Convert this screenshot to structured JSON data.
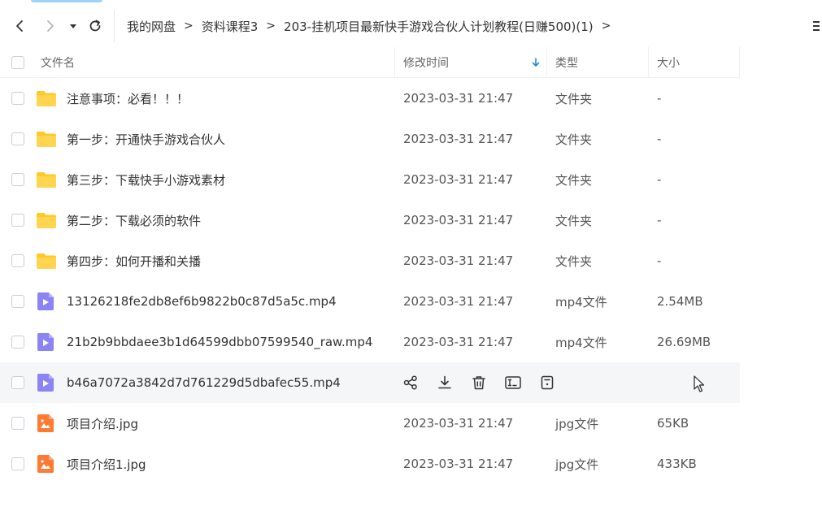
{
  "breadcrumbs": [
    "我的网盘",
    "资料课程3",
    "203-挂机项目最新快手游戏合伙人计划教程(日赚500)(1)"
  ],
  "crumb_separator": ">",
  "columns": {
    "name": "文件名",
    "modified": "修改时间",
    "type": "类型",
    "size": "大小"
  },
  "sort": {
    "column": "modified",
    "direction": "descending"
  },
  "files": [
    {
      "icon": "folder-icon",
      "name": "注意事项：必看！！！",
      "modified": "2023-03-31 21:47",
      "type": "文件夹",
      "size": "-"
    },
    {
      "icon": "folder-icon",
      "name": "第一步：开通快手游戏合伙人",
      "modified": "2023-03-31 21:47",
      "type": "文件夹",
      "size": "-"
    },
    {
      "icon": "folder-icon",
      "name": "第三步：下载快手小游戏素材",
      "modified": "2023-03-31 21:47",
      "type": "文件夹",
      "size": "-"
    },
    {
      "icon": "folder-icon",
      "name": "第二步：下载必须的软件",
      "modified": "2023-03-31 21:47",
      "type": "文件夹",
      "size": "-"
    },
    {
      "icon": "folder-icon",
      "name": "第四步：如何开播和关播",
      "modified": "2023-03-31 21:47",
      "type": "文件夹",
      "size": "-"
    },
    {
      "icon": "video-file-icon",
      "name": "13126218fe2db8ef6b9822b0c87d5a5c.mp4",
      "modified": "2023-03-31 21:47",
      "type": "mp4文件",
      "size": "2.54MB"
    },
    {
      "icon": "video-file-icon",
      "name": "21b2b9bbdaee3b1d64599dbb07599540_raw.mp4",
      "modified": "2023-03-31 21:47",
      "type": "mp4文件",
      "size": "26.69MB"
    },
    {
      "icon": "video-file-icon",
      "name": "b46a7072a3842d7d761229d5dbafec55.mp4",
      "modified": "",
      "type": "",
      "size": "",
      "hovered": true
    },
    {
      "icon": "image-file-icon",
      "name": "项目介绍.jpg",
      "modified": "2023-03-31 21:47",
      "type": "jpg文件",
      "size": "65KB"
    },
    {
      "icon": "image-file-icon",
      "name": "项目介绍1.jpg",
      "modified": "2023-03-31 21:47",
      "type": "jpg文件",
      "size": "433KB"
    }
  ],
  "hover_actions": [
    "share-icon",
    "download-icon",
    "delete-icon",
    "rename-icon",
    "more-file-icon"
  ],
  "colors": {
    "folder": "#FFCA28",
    "video": "#8C84F5",
    "image": "#FF7A33",
    "sort_arrow": "#1E88E5",
    "hover_row": "#F5F6F8"
  }
}
